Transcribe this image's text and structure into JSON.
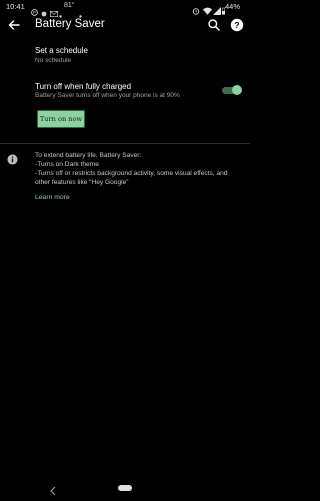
{
  "status_bar": {
    "time": "10:41",
    "notification_icons": [
      "notification-icon-p",
      "notification-icon-dot",
      "notification-icon-mail"
    ],
    "temperature": "81°",
    "battery_percent": "44%"
  },
  "app_bar": {
    "title": "Battery Saver"
  },
  "schedule": {
    "title": "Set a schedule",
    "subtitle": "No schedule"
  },
  "turn_off_setting": {
    "title": "Turn off when fully charged",
    "subtitle": "Battery Saver turns off when your phone is at 90%",
    "enabled": true
  },
  "turn_on_button": {
    "label": "Turn on now"
  },
  "info": {
    "lines": [
      "To extend battery life, Battery Saver:",
      "-Turns on Dark theme",
      "-Turns off or restricts background activity, some visual effects, and",
      "other features like “Hey Google”"
    ],
    "learn_more": "Learn more"
  },
  "colors": {
    "background": "#000000",
    "accent": "#8fd19e",
    "text_primary": "#ffffff",
    "text_secondary": "#a0a0a0"
  }
}
